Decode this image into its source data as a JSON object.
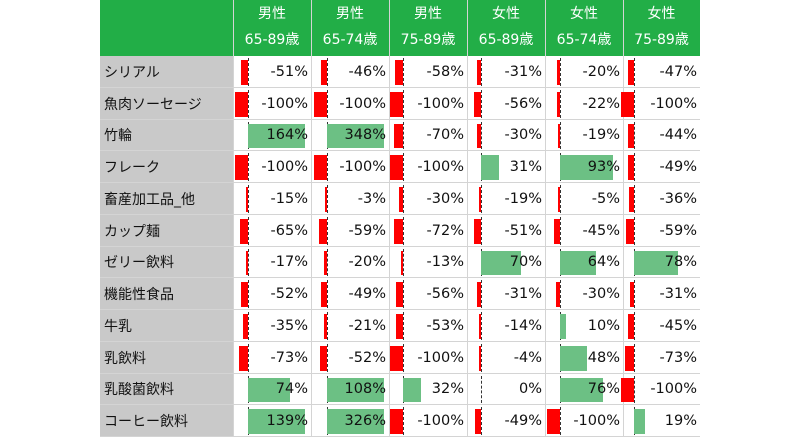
{
  "colors": {
    "header": "#22ae47",
    "positive": "#6cc084",
    "negative": "#ff0000",
    "label_bg": "#c9c9c9"
  },
  "chart_data": {
    "type": "table",
    "columns": [
      {
        "line1": "男性",
        "line2": "65-89歳"
      },
      {
        "line1": "男性",
        "line2": "65-74歳"
      },
      {
        "line1": "男性",
        "line2": "75-89歳"
      },
      {
        "line1": "女性",
        "line2": "65-89歳"
      },
      {
        "line1": "女性",
        "line2": "65-74歳"
      },
      {
        "line1": "女性",
        "line2": "75-89歳"
      }
    ],
    "rows": [
      {
        "label": "シリアル",
        "values": [
          -51,
          -46,
          -58,
          -31,
          -20,
          -47
        ],
        "display": [
          "-51%",
          "-46%",
          "-58%",
          "-31%",
          "-20%",
          "-47%"
        ]
      },
      {
        "label": "魚肉ソーセージ",
        "values": [
          -100,
          -100,
          -100,
          -56,
          -22,
          -100
        ],
        "display": [
          "-100%",
          "-100%",
          "-100%",
          "-56%",
          "-22%",
          "-100%"
        ]
      },
      {
        "label": "竹輪",
        "values": [
          164,
          348,
          -70,
          -30,
          -19,
          -44
        ],
        "display": [
          "164%",
          "348%",
          "-70%",
          "-30%",
          "-19%",
          "-44%"
        ]
      },
      {
        "label": "フレーク",
        "values": [
          -100,
          -100,
          -100,
          31,
          93,
          -49
        ],
        "display": [
          "-100%",
          "-100%",
          "-100%",
          "31%",
          "93%",
          "-49%"
        ]
      },
      {
        "label": "畜産加工品_他",
        "values": [
          -15,
          -3,
          -30,
          -19,
          -5,
          -36
        ],
        "display": [
          "-15%",
          "-3%",
          "-30%",
          "-19%",
          "-5%",
          "-36%"
        ]
      },
      {
        "label": "カップ麺",
        "values": [
          -65,
          -59,
          -72,
          -51,
          -45,
          -59
        ],
        "display": [
          "-65%",
          "-59%",
          "-72%",
          "-51%",
          "-45%",
          "-59%"
        ]
      },
      {
        "label": "ゼリー飲料",
        "values": [
          -17,
          -20,
          -13,
          70,
          64,
          78
        ],
        "display": [
          "-17%",
          "-20%",
          "-13%",
          "70%",
          "64%",
          "78%"
        ]
      },
      {
        "label": "機能性食品",
        "values": [
          -52,
          -49,
          -56,
          -31,
          -30,
          -31
        ],
        "display": [
          "-52%",
          "-49%",
          "-56%",
          "-31%",
          "-30%",
          "-31%"
        ]
      },
      {
        "label": "牛乳",
        "values": [
          -35,
          -21,
          -53,
          -14,
          10,
          -45
        ],
        "display": [
          "-35%",
          "-21%",
          "-53%",
          "-14%",
          "10%",
          "-45%"
        ]
      },
      {
        "label": "乳飲料",
        "values": [
          -73,
          -52,
          -100,
          -4,
          48,
          -73
        ],
        "display": [
          "-73%",
          "-52%",
          "-100%",
          "-4%",
          "48%",
          "-73%"
        ]
      },
      {
        "label": "乳酸菌飲料",
        "values": [
          74,
          108,
          32,
          0,
          76,
          -100
        ],
        "display": [
          "74%",
          "108%",
          "32%",
          "0%",
          "76%",
          "-100%"
        ]
      },
      {
        "label": "コーヒー飲料",
        "values": [
          139,
          326,
          -100,
          -49,
          -100,
          19
        ],
        "display": [
          "139%",
          "326%",
          "-100%",
          "-49%",
          "-100%",
          "19%"
        ]
      }
    ]
  }
}
